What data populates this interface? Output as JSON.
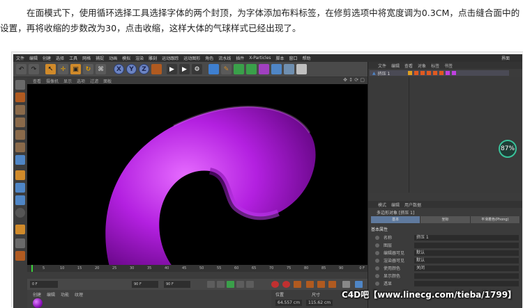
{
  "intro": {
    "line1": "在面模式下，使用循环选择工具选择字体的两个封顶，为字体添加布料标签，在修剪选项中将宽度调为0.3CM，点击缝合面中的",
    "line2": "设置，再将收缩的步数改为30，点击收缩，这样大体的气球样式已经出现了。"
  },
  "c4d": {
    "menu": [
      "文件",
      "编辑",
      "创建",
      "选择",
      "工具",
      "网格",
      "捕捉",
      "动画",
      "模拟",
      "渲染",
      "雕刻",
      "运动跟踪",
      "运动图形",
      "角色",
      "流水线",
      "插件",
      "X-Particles",
      "脚本",
      "窗口",
      "帮助"
    ],
    "layout_label": "界面",
    "toolbar_axes": [
      "X",
      "Y",
      "Z"
    ],
    "viewport_menu": [
      "查看",
      "摄像机",
      "显示",
      "选项",
      "过滤",
      "面板"
    ],
    "timeline_ticks": [
      "5",
      "10",
      "15",
      "20",
      "25",
      "30",
      "35",
      "40",
      "45",
      "50",
      "55",
      "60",
      "65",
      "70",
      "75",
      "80",
      "85",
      "90"
    ],
    "timeline_end": "0 F",
    "frame_start": "0 F",
    "frame_end": "90 F",
    "frame_end2": "90 F",
    "material_menu": [
      "创建",
      "编辑",
      "功能",
      "纹理"
    ],
    "coords_headers": [
      "位置",
      "尺寸",
      "旋转"
    ],
    "coords_pos": "64.557 cm",
    "coords_size": "115.62 cm",
    "object_menu": [
      "文件",
      "编辑",
      "查看",
      "对象",
      "标签",
      "书签"
    ],
    "object_name": "挤压 1",
    "badge": "87",
    "attr_menu": [
      "模式",
      "编辑",
      "用户数据"
    ],
    "attr_title": "多边形对象 [挤压 1]",
    "attr_tabs": [
      "基本",
      "坐标",
      "平滑着色(Phong)"
    ],
    "attr_section": "基本属性",
    "attr_rows": [
      {
        "label": "名称",
        "value": "挤压 1"
      },
      {
        "label": "图层",
        "value": ""
      },
      {
        "label": "编辑器可见",
        "value": "默认"
      },
      {
        "label": "渲染器可见",
        "value": "默认"
      },
      {
        "label": "使用颜色",
        "value": "关闭"
      },
      {
        "label": "显示颜色",
        "value": ""
      },
      {
        "label": "透显",
        "value": ""
      }
    ],
    "shape_color": "#b320e0"
  },
  "watermark": "C4D吧【www.linecg.com/tieba/1799】"
}
